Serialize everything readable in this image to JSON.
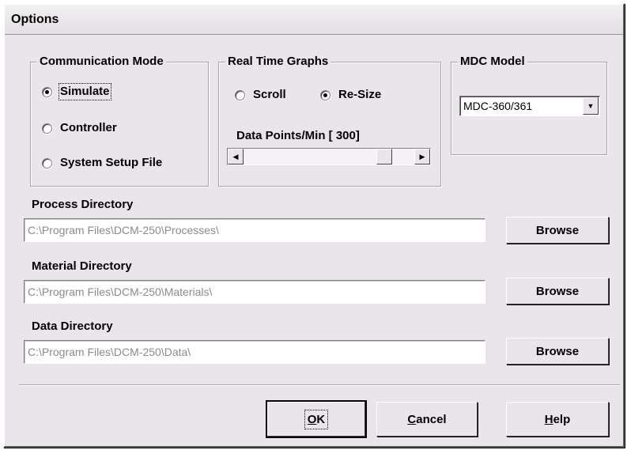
{
  "window": {
    "title": "Options"
  },
  "communication_mode": {
    "label": "Communication Mode",
    "options": [
      {
        "label": "Simulate",
        "checked": true
      },
      {
        "label": "Controller",
        "checked": false
      },
      {
        "label": "System Setup File",
        "checked": false
      }
    ]
  },
  "real_time_graphs": {
    "label": "Real Time Graphs",
    "options": [
      {
        "label": "Scroll",
        "checked": false
      },
      {
        "label": "Re-Size",
        "checked": true
      }
    ],
    "data_points_label": "Data Points/Min [ 300]",
    "data_points_value": 300
  },
  "mdc_model": {
    "label": "MDC Model",
    "selected": "MDC-360/361"
  },
  "directories": [
    {
      "label": "Process Directory",
      "value": "C:\\Program Files\\DCM-250\\Processes\\",
      "browse_label": "Browse"
    },
    {
      "label": "Material Directory",
      "value": "C:\\Program Files\\DCM-250\\Materials\\",
      "browse_label": "Browse"
    },
    {
      "label": "Data Directory",
      "value": "C:\\Program Files\\DCM-250\\Data\\",
      "browse_label": "Browse"
    }
  ],
  "buttons": {
    "ok": {
      "mnemonic": "O",
      "rest": "K"
    },
    "cancel": {
      "mnemonic": "C",
      "rest": "ancel"
    },
    "help": {
      "mnemonic": "H",
      "rest": "elp"
    }
  },
  "icons": {
    "scroll_left": "◀",
    "scroll_right": "▶",
    "dropdown": "▼"
  }
}
